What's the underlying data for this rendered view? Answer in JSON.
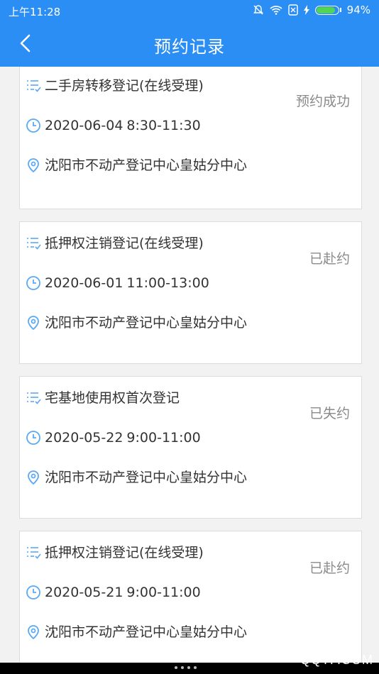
{
  "status_bar": {
    "time": "上午11:28",
    "battery": "94%",
    "battery_level": 0.94
  },
  "header": {
    "title": "预约记录"
  },
  "records": [
    {
      "service": "二手房转移登记(在线受理)",
      "date": "2020-06-04",
      "time": "8:30-11:30",
      "address": "沈阳市不动产登记中心皇姑分中心",
      "status": "预约成功"
    },
    {
      "service": "抵押权注销登记(在线受理)",
      "date": "2020-06-01",
      "time": "11:00-13:00",
      "address": "沈阳市不动产登记中心皇姑分中心",
      "status": "已赴约"
    },
    {
      "service": "宅基地使用权首次登记",
      "date": "2020-05-22",
      "time": "9:00-11:00",
      "address": "沈阳市不动产登记中心皇姑分中心",
      "status": "已失约"
    },
    {
      "service": "抵押权注销登记(在线受理)",
      "date": "2020-05-21",
      "time": "9:00-11:00",
      "address": "沈阳市不动产登记中心皇姑分中心",
      "status": "已赴约"
    }
  ],
  "watermark": "QQTF.COM",
  "colors": {
    "primary": "#2a8ef4",
    "icon": "#5aa9f6",
    "status": "#8a8a8a"
  }
}
